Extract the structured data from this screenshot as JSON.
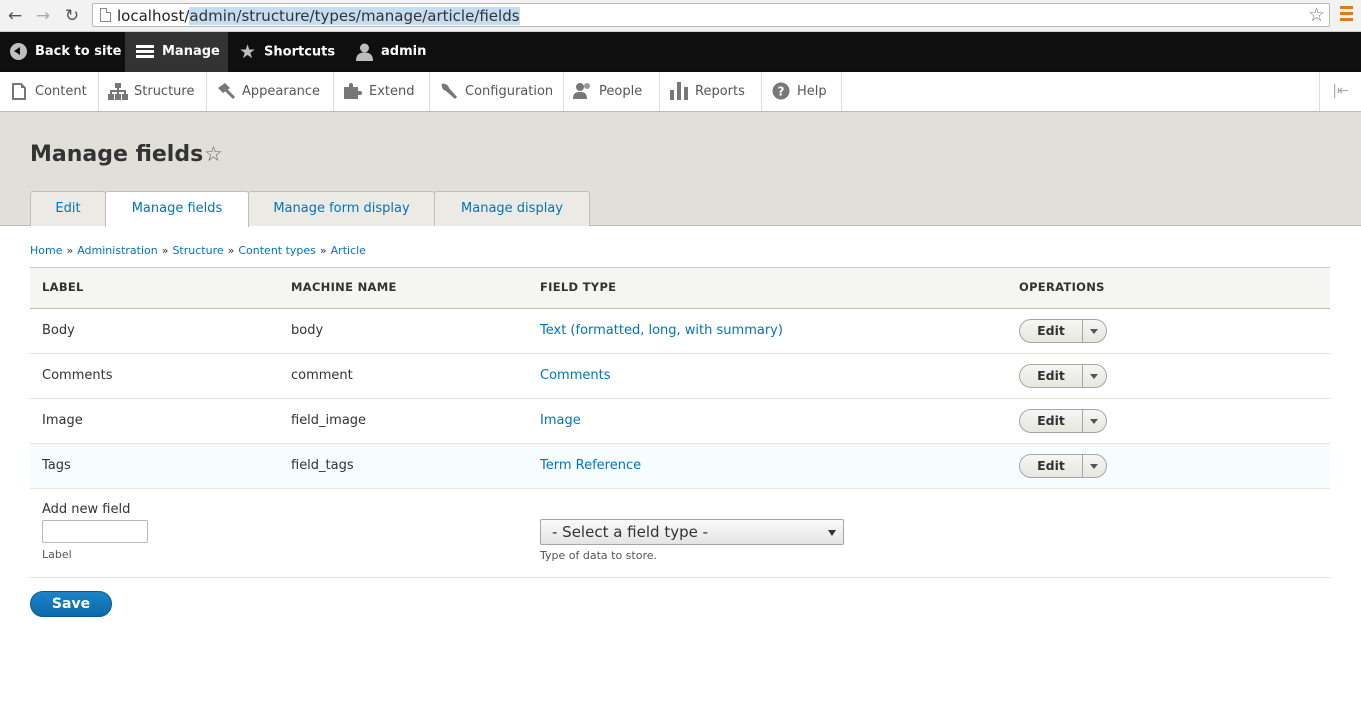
{
  "browser": {
    "url_host": "localhost/",
    "url_path": "admin/structure/types/manage/article/fields",
    "back_icon": "back-arrow-icon",
    "forward_icon": "forward-arrow-icon",
    "reload_icon": "reload-icon"
  },
  "toolbar": {
    "back_label": "Back to site",
    "manage_label": "Manage",
    "shortcuts_label": "Shortcuts",
    "user_label": "admin"
  },
  "admin_menu": {
    "items": [
      {
        "label": "Content",
        "icon": "file-icon"
      },
      {
        "label": "Structure",
        "icon": "sitemap-icon"
      },
      {
        "label": "Appearance",
        "icon": "paintbrush-icon"
      },
      {
        "label": "Extend",
        "icon": "puzzle-icon"
      },
      {
        "label": "Configuration",
        "icon": "wrench-icon"
      },
      {
        "label": "People",
        "icon": "people-icon"
      },
      {
        "label": "Reports",
        "icon": "bar-chart-icon"
      },
      {
        "label": "Help",
        "icon": "help-icon"
      }
    ]
  },
  "page": {
    "title": "Manage fields",
    "tabs": [
      {
        "label": "Edit",
        "active": false
      },
      {
        "label": "Manage fields",
        "active": true
      },
      {
        "label": "Manage form display",
        "active": false
      },
      {
        "label": "Manage display",
        "active": false
      }
    ]
  },
  "breadcrumb": [
    "Home",
    "Administration",
    "Structure",
    "Content types",
    "Article"
  ],
  "breadcrumb_separator": "»",
  "table": {
    "headers": [
      "LABEL",
      "MACHINE NAME",
      "FIELD TYPE",
      "OPERATIONS"
    ],
    "rows": [
      {
        "label": "Body",
        "machine_name": "body",
        "field_type": "Text (formatted, long, with summary)",
        "operation": "Edit"
      },
      {
        "label": "Comments",
        "machine_name": "comment",
        "field_type": "Comments",
        "operation": "Edit"
      },
      {
        "label": "Image",
        "machine_name": "field_image",
        "field_type": "Image",
        "operation": "Edit"
      },
      {
        "label": "Tags",
        "machine_name": "field_tags",
        "field_type": "Term Reference",
        "operation": "Edit"
      }
    ]
  },
  "add_field": {
    "title": "Add new field",
    "label_value": "",
    "label_desc": "Label",
    "select_value": "- Select a field type -",
    "select_desc": "Type of data to store."
  },
  "actions": {
    "save_label": "Save"
  },
  "colors": {
    "link": "#0074bd",
    "toolbar_dark": "#0f0f0f",
    "header_bg": "#e0e0d8",
    "primary_button": "#0a6aab"
  }
}
